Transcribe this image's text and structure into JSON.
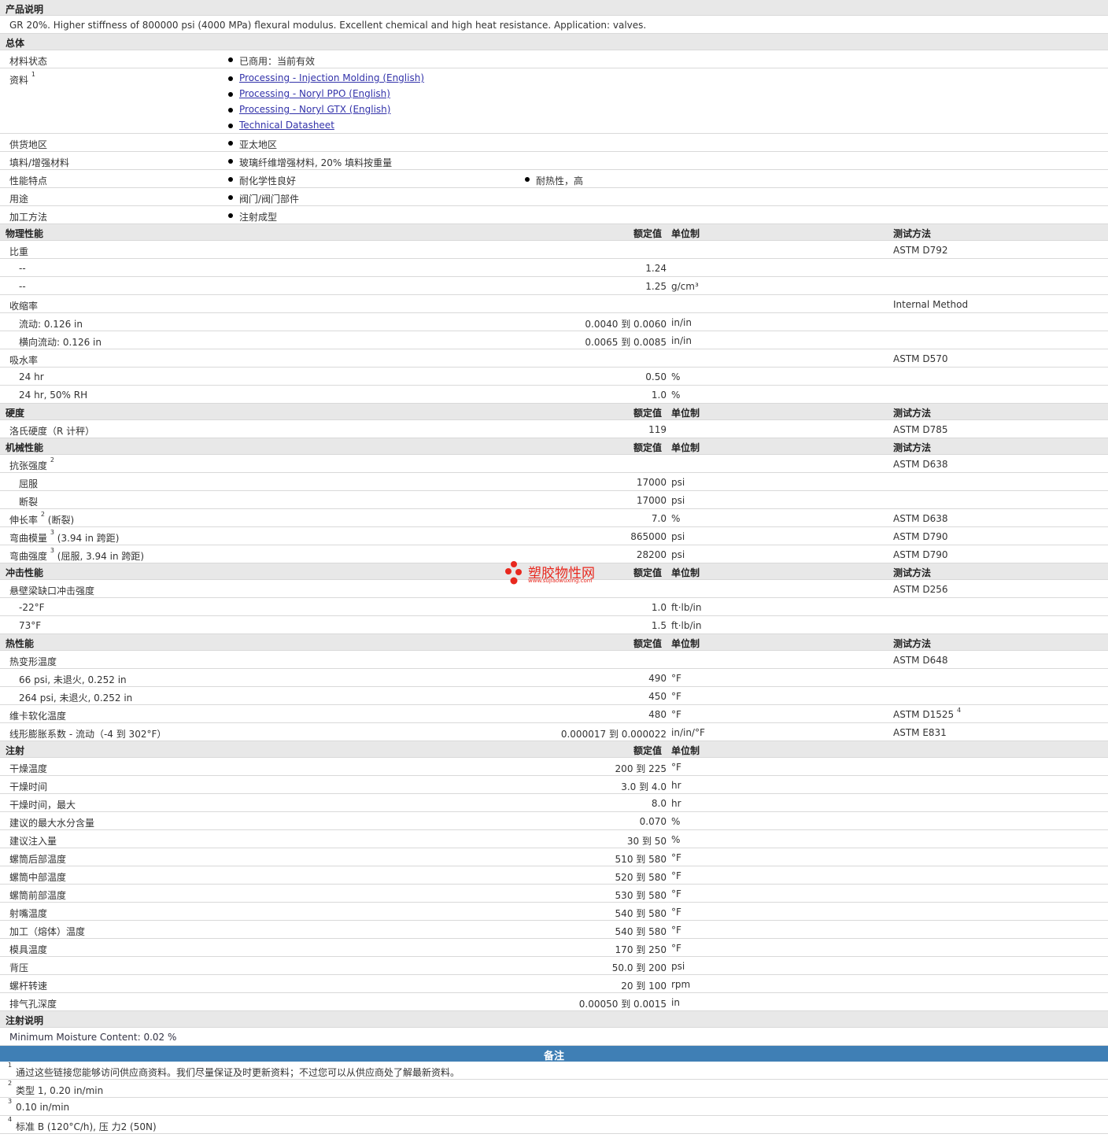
{
  "product": {
    "header": "产品说明",
    "description": "GR 20%. Higher stiffness of 800000 psi (4000 MPa) flexural modulus. Excellent chemical and high heat resistance. Application: valves."
  },
  "general": {
    "header": "总体",
    "status_label": "材料状态",
    "status_value": "已商用：当前有效",
    "docs_label": "资料",
    "docs_sup": "1",
    "docs": [
      "Processing - Injection Molding (English)",
      "Processing - Noryl PPO (English)",
      "Processing - Noryl GTX (English)",
      "Technical Datasheet"
    ],
    "region_label": "供货地区",
    "region_value": "亚太地区",
    "filler_label": "填料/增强材料",
    "filler_value": "玻璃纤维增强材料, 20% 填料按重量",
    "features_label": "性能特点",
    "features_values": [
      "耐化学性良好",
      "耐热性，高"
    ],
    "uses_label": "用途",
    "uses_value": "阀门/阀门部件",
    "process_label": "加工方法",
    "process_value": "注射成型"
  },
  "col": {
    "nominal": "额定值",
    "unit": "单位制",
    "test": "测试方法"
  },
  "physical": {
    "header": "物理性能",
    "sg_label": "比重",
    "sg_test": "ASTM D792",
    "sg1_label": "--",
    "sg1_val": "1.24",
    "sg2_label": "--",
    "sg2_val": "1.25",
    "sg2_unit": "g/cm³",
    "shrink_label": "收缩率",
    "shrink_test": "Internal Method",
    "flow_label": "流动: 0.126 in",
    "flow_val": "0.0040 到  0.0060",
    "flow_unit": "in/in",
    "xflow_label": "横向流动: 0.126 in",
    "xflow_val": "0.0065 到  0.0085",
    "xflow_unit": "in/in",
    "abs_label": "吸水率",
    "abs_test": "ASTM D570",
    "abs1_label": "24 hr",
    "abs1_val": "0.50",
    "abs1_unit": "%",
    "abs2_label": "24 hr, 50% RH",
    "abs2_val": "1.0",
    "abs2_unit": "%"
  },
  "hardness": {
    "header": "硬度",
    "r_label": "洛氏硬度（R 计秤）",
    "r_val": "119",
    "r_test": "ASTM D785"
  },
  "mech": {
    "header": "机械性能",
    "ts_label": "抗张强度",
    "ts_sup": "2",
    "ts_test": "ASTM D638",
    "yield_label": "屈服",
    "yield_val": "17000",
    "yield_unit": "psi",
    "break_label": "断裂",
    "break_val": "17000",
    "break_unit": "psi",
    "elong_label": "伸长率",
    "elong_sup": "2",
    "elong_suffix": "(断裂)",
    "elong_val": "7.0",
    "elong_unit": "%",
    "elong_test": "ASTM D638",
    "fm_label": "弯曲模量",
    "fm_sup": "3",
    "fm_suffix": "(3.94 in 跨距)",
    "fm_val": "865000",
    "fm_unit": "psi",
    "fm_test": "ASTM D790",
    "fs_label": "弯曲强度",
    "fs_sup": "3",
    "fs_suffix": "(屈服, 3.94 in 跨距)",
    "fs_val": "28200",
    "fs_unit": "psi",
    "fs_test": "ASTM D790"
  },
  "impact": {
    "header": "冲击性能",
    "izod_label": "悬壁梁缺口冲击强度",
    "izod_test": "ASTM D256",
    "i1_label": "-22°F",
    "i1_val": "1.0",
    "i1_unit": "ft·lb/in",
    "i2_label": "73°F",
    "i2_val": "1.5",
    "i2_unit": "ft·lb/in"
  },
  "watermark": {
    "text": "塑胶物性网",
    "url": "www.sujiaowuxing.com"
  },
  "thermal": {
    "header": "热性能",
    "hdt_label": "热变形温度",
    "hdt_test": "ASTM D648",
    "h1_label": "66 psi, 未退火, 0.252 in",
    "h1_val": "490",
    "h1_unit": "°F",
    "h2_label": "264 psi, 未退火, 0.252 in",
    "h2_val": "450",
    "h2_unit": "°F",
    "vicat_label": "维卡软化温度",
    "vicat_val": "480",
    "vicat_unit": "°F",
    "vicat_test": "ASTM D1525",
    "vicat_sup": "4",
    "clte_label": "线形膨胀系数 - 流动（-4 到  302°F）",
    "clte_val": "0.000017 到  0.000022",
    "clte_unit": "in/in/°F",
    "clte_test": "ASTM E831"
  },
  "injection": {
    "header": "注射",
    "rows": [
      {
        "label": "干燥温度",
        "val": "200 到  225",
        "unit": "°F"
      },
      {
        "label": "干燥时间",
        "val": "3.0 到  4.0",
        "unit": "hr"
      },
      {
        "label": "干燥时间，最大",
        "val": "8.0",
        "unit": "hr"
      },
      {
        "label": "建议的最大水分含量",
        "val": "0.070",
        "unit": "%"
      },
      {
        "label": "建议注入量",
        "val": "30 到  50",
        "unit": "%"
      },
      {
        "label": "螺筒后部温度",
        "val": "510 到  580",
        "unit": "°F"
      },
      {
        "label": "螺筒中部温度",
        "val": "520 到  580",
        "unit": "°F"
      },
      {
        "label": "螺筒前部温度",
        "val": "530 到  580",
        "unit": "°F"
      },
      {
        "label": "射嘴温度",
        "val": "540 到  580",
        "unit": "°F"
      },
      {
        "label": "加工（熔体）温度",
        "val": "540 到  580",
        "unit": "°F"
      },
      {
        "label": "模具温度",
        "val": "170 到  250",
        "unit": "°F"
      },
      {
        "label": "背压",
        "val": "50.0 到  200",
        "unit": "psi"
      },
      {
        "label": "螺杆转速",
        "val": "20 到  100",
        "unit": "rpm"
      },
      {
        "label": "排气孔深度",
        "val": "0.00050 到  0.0015",
        "unit": "in"
      }
    ]
  },
  "inj_notes": {
    "header": "注射说明",
    "text": "Minimum Moisture Content: 0.02 %"
  },
  "notes": {
    "header": "备注",
    "items": [
      {
        "num": "1",
        "text": "通过这些链接您能够访问供应商资料。我们尽量保证及时更新资料；不过您可以从供应商处了解最新资料。"
      },
      {
        "num": "2",
        "text": "类型  1, 0.20 in/min"
      },
      {
        "num": "3",
        "text": "0.10 in/min"
      },
      {
        "num": "4",
        "text": "标准  B (120°C/h), 压  力2 (50N)"
      }
    ]
  }
}
